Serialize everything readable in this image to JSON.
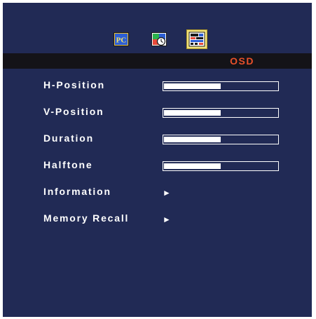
{
  "menu_title": "OSD",
  "icons": [
    {
      "name": "pc-icon",
      "selected": false
    },
    {
      "name": "image-clock-icon",
      "selected": false
    },
    {
      "name": "osd-settings-icon",
      "selected": true
    }
  ],
  "items": [
    {
      "label": "H-Position",
      "level_percent": 50
    },
    {
      "label": "V-Position",
      "level_percent": 50
    },
    {
      "label": "Duration",
      "level_percent": 50
    },
    {
      "label": "Halftone",
      "level_percent": 50
    },
    {
      "label": "Information",
      "arrow": "►"
    },
    {
      "label": "Memory Recall",
      "arrow": "►"
    }
  ],
  "colors": {
    "background": "#212a55",
    "title_bar": "#141318",
    "title_text": "#e8502a",
    "selected_icon_bg": "#f1e27c"
  }
}
